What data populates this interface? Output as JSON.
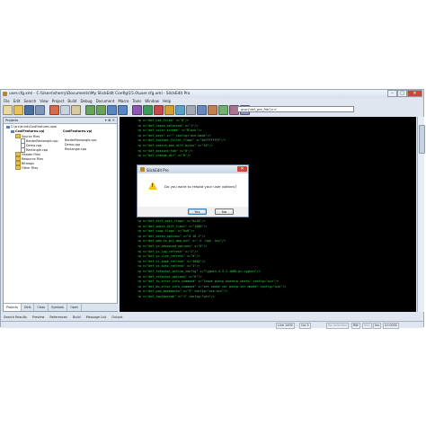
{
  "window": {
    "title": "user.cfg.xml - C:\\Users\\sherry\\Documents\\My SlickEdit Config\\15.0\\user.cfg.xml - SlickEdit Pro",
    "menus": [
      "File",
      "Edit",
      "Search",
      "View",
      "Project",
      "Build",
      "Debug",
      "Document",
      "Macro",
      "Tools",
      "Window",
      "Help"
    ],
    "caption": {
      "minimize": "–",
      "maximize": "□",
      "close": "✕"
    }
  },
  "toolbar": {
    "combo_value": "proc('def_pre_file')>>'"
  },
  "project_pane": {
    "header": "Projects",
    "tree": [
      {
        "label": "C:\\src\\trunk\\CoolFeatures.vpw",
        "bold": false
      },
      {
        "label": "CoolFeatures.vpj",
        "bold": true
      },
      {
        "label": "CoolFeatures.vpj",
        "bold": true
      },
      {
        "label": "Source Files",
        "bold": false
      },
      {
        "label": "BorderRectangle.cpp",
        "bold": false
      },
      {
        "label": "BorderRectangle.cpp",
        "bold": false
      },
      {
        "label": "Demo.cpp",
        "bold": false
      },
      {
        "label": "Demo.cpp",
        "bold": false
      },
      {
        "label": "Rectangle.cpp",
        "bold": false
      },
      {
        "label": "Rectangle.cpp",
        "bold": false
      },
      {
        "label": "Header Files",
        "bold": false
      },
      {
        "label": "Resource Files",
        "bold": false
      },
      {
        "label": "Bitmaps",
        "bold": false
      },
      {
        "label": "Other Files",
        "bold": false
      }
    ],
    "tabs": [
      "Projects",
      "Defs",
      "Class",
      "Symbols",
      "Open"
    ]
  },
  "editor": {
    "lines": [
      "<p n=\"def_use_fileh\" v=\"0\"/>",
      "<p n=\"def_leave_selected\" v=\"1\"/>",
      "<p n=\"def_color_scheme\" v=\"Black\"/>",
      "<p n=\"def_keys\" v=\"\" config=\"ace-mode\"/>",
      "<p n=\"def_toolbar_filter_flags\" v=\"0xFFFFFFFF\"/>",
      "<p n=\"def_search_max_diff_bytes\" v=\"10\"/>",
      "<p n=\"def_options_tab\" v=\"0\"/>",
      "<p n=\"def_change_dir\" v=\"0\"/>",
      "",
      "",
      "",
      "",
      "",
      "",
      "",
      "",
      "",
      "",
      "",
      "<p n=\"def_diff_flags\" v=\"0x80\"/>",
      "<p n=\"def_diff_edit_flags\" v=\"0x28\"/>",
      "<p n=\"def_smart_diff_limit\" v=\"1000\"/>",
      "<p n=\"def_vcpp_flags\" v=\"0x6\"/>",
      "<p n=\"def_kbrep_options\" v=\"0 10 2\"/>",
      "<p n=\"def_add_to_prj_dep_ext\" v=\".h .hpp .hxx\"/>",
      "<p n=\"def_vc_advanced_options\" v=\"0\"/>",
      "<p n=\"def_vc_log_refresh\" v=\"2\"/>",
      "<p n=\"def_vc_live_refresh\" v=\"0\"/>",
      "<p n=\"def_vc_page_refresh\" v=\"4000\"/>",
      "<p n=\"def_vc_auto_refresh\" v=\"1\"/>",
      "<p n=\"def_refactor_active_config\" v=\"Cygwin-4.3.2-i686-pc-cygwin\"/>",
      "<p n=\"def_refactor_options\" v=\"0\"/>",
      "<p n=\"def_tw_error_info_command\" v=\"leave pkexp pkexerp wnerp\" config=\"win\"/>",
      "<p n=\"def_bw_error_info_command\" v=\"set cmake ver pkexp ver mmake\" config=\"win\"/>",
      "<p n=\"def_pop_bookmarks\" v=\"5\" config=\"ace-win\"/>",
      "<p n=\"def_toolbartab\" v=\"1\" config=\"win\"/>"
    ]
  },
  "bottom_tabs": [
    "Search Results",
    "Preview",
    "References",
    "Build",
    "Message List",
    "Output"
  ],
  "statusbar": {
    "line": "Line 1492",
    "col": "Col 5",
    "selection": "No Selection",
    "rw": "RW",
    "rec": "REC",
    "ins": "Ins",
    "encoding": "U+003C"
  },
  "dialog": {
    "title": "SlickEdit Pro",
    "message": "Do you want to reload your user options?",
    "yes_label": "Yes",
    "no_label": "No",
    "close": "✕",
    "icon_mark": "!"
  },
  "colors": {
    "code_green": "#2fd44a",
    "editor_bg": "#000000",
    "window_chrome": "#dfe6ef",
    "warning_yellow": "#f3c51c"
  }
}
